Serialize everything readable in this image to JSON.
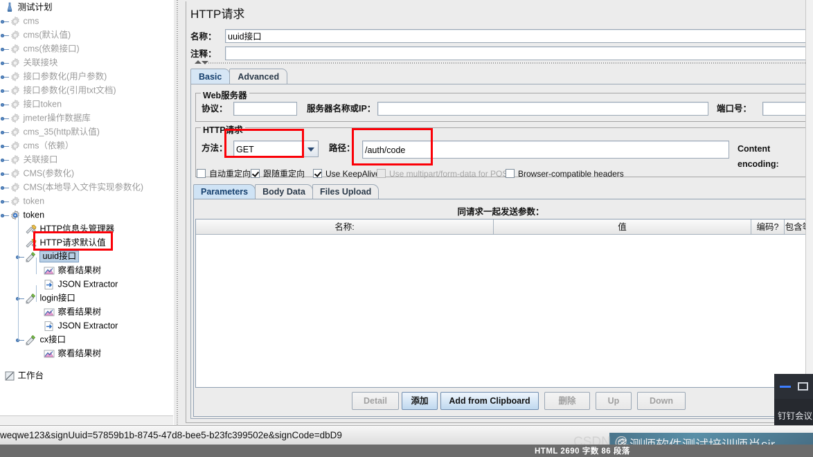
{
  "app": {
    "title": "HTTP请求"
  },
  "tree": {
    "rows": [
      {
        "label": "测试计划",
        "icon": "test-plan-icon",
        "depth": 0,
        "handle": false,
        "dim": false
      },
      {
        "label": "cms",
        "icon": "thread-group-icon",
        "depth": 1,
        "handle": true,
        "dim": true
      },
      {
        "label": "cms(默认值)",
        "icon": "thread-group-icon",
        "depth": 1,
        "handle": true,
        "dim": true
      },
      {
        "label": "cms(依赖接口)",
        "icon": "thread-group-icon",
        "depth": 1,
        "handle": true,
        "dim": true
      },
      {
        "label": "关联接块",
        "icon": "thread-group-icon",
        "depth": 1,
        "handle": true,
        "dim": true
      },
      {
        "label": "接口参数化(用户参数)",
        "icon": "thread-group-icon",
        "depth": 1,
        "handle": true,
        "dim": true
      },
      {
        "label": "接口参数化(引用txt文档)",
        "icon": "thread-group-icon",
        "depth": 1,
        "handle": true,
        "dim": true
      },
      {
        "label": "接口token",
        "icon": "thread-group-icon",
        "depth": 1,
        "handle": true,
        "dim": true
      },
      {
        "label": "jmeter操作数据库",
        "icon": "thread-group-icon",
        "depth": 1,
        "handle": true,
        "dim": true
      },
      {
        "label": "cms_35(http默认值)",
        "icon": "thread-group-icon",
        "depth": 1,
        "handle": true,
        "dim": true
      },
      {
        "label": "cms（依赖）",
        "icon": "thread-group-icon",
        "depth": 1,
        "handle": true,
        "dim": true
      },
      {
        "label": "关联接口",
        "icon": "thread-group-icon",
        "depth": 1,
        "handle": true,
        "dim": true
      },
      {
        "label": "CMS(参数化)",
        "icon": "thread-group-icon",
        "depth": 1,
        "handle": true,
        "dim": true
      },
      {
        "label": "CMS(本地导入文件实现参数化)",
        "icon": "thread-group-icon",
        "depth": 1,
        "handle": true,
        "dim": true
      },
      {
        "label": "token",
        "icon": "thread-group-icon",
        "depth": 1,
        "handle": true,
        "dim": true
      },
      {
        "label": "token",
        "icon": "thread-group-active-icon",
        "depth": 1,
        "handle": true,
        "dim": false
      },
      {
        "label": "HTTP信息头管理器",
        "icon": "config-wrench-icon",
        "depth": 2,
        "handle": false,
        "dim": false
      },
      {
        "label": "HTTP请求默认值",
        "icon": "config-wrench-icon",
        "depth": 2,
        "handle": false,
        "dim": false
      },
      {
        "label": "uuid接口",
        "icon": "http-sampler-icon",
        "depth": 2,
        "handle": true,
        "dim": false,
        "selected": true
      },
      {
        "label": "察看结果树",
        "icon": "view-results-tree-icon",
        "depth": 3,
        "handle": false,
        "dim": false
      },
      {
        "label": "JSON Extractor",
        "icon": "json-extractor-icon",
        "depth": 3,
        "handle": false,
        "dim": false
      },
      {
        "label": "login接口",
        "icon": "http-sampler-icon",
        "depth": 2,
        "handle": true,
        "dim": false
      },
      {
        "label": "察看结果树",
        "icon": "view-results-tree-icon",
        "depth": 3,
        "handle": false,
        "dim": false
      },
      {
        "label": "JSON Extractor",
        "icon": "json-extractor-icon",
        "depth": 3,
        "handle": false,
        "dim": false
      },
      {
        "label": "cx接口",
        "icon": "http-sampler-icon",
        "depth": 2,
        "handle": true,
        "dim": false
      },
      {
        "label": "察看结果树",
        "icon": "view-results-tree-icon",
        "depth": 3,
        "handle": false,
        "dim": false
      },
      {
        "label": "工作台",
        "icon": "workbench-icon",
        "depth": 0,
        "handle": false,
        "dim": false
      }
    ]
  },
  "form": {
    "name_label": "名称：",
    "name_value": "uuid接口",
    "comment_label": "注释：",
    "comment_value": ""
  },
  "top_tabs": [
    {
      "label": "Basic",
      "active": true
    },
    {
      "label": "Advanced",
      "active": false
    }
  ],
  "webserver": {
    "legend": "Web服务器",
    "protocol_label": "协议：",
    "protocol_value": "",
    "server_label": "服务器名称或IP：",
    "server_value": "",
    "port_label": "端口号：",
    "port_value": ""
  },
  "httprequest": {
    "legend": "HTTP请求",
    "method_label": "方法：",
    "method_value": "GET",
    "path_label": "路径：",
    "path_value": "/auth/code",
    "encoding_label": "Content encoding:",
    "encoding_value": ""
  },
  "checkboxes": [
    {
      "label": "自动重定向",
      "checked": false,
      "disabled": false
    },
    {
      "label": "跟随重定向",
      "checked": true,
      "disabled": false
    },
    {
      "label": "Use KeepAlive",
      "checked": true,
      "disabled": false
    },
    {
      "label": "Use multipart/form-data for POST",
      "checked": false,
      "disabled": true
    },
    {
      "label": "Browser-compatible headers",
      "checked": false,
      "disabled": false
    }
  ],
  "param_tabs": [
    {
      "label": "Parameters",
      "active": true
    },
    {
      "label": "Body Data",
      "active": false
    },
    {
      "label": "Files Upload",
      "active": false
    }
  ],
  "params_table": {
    "title": "同请求一起发送参数：",
    "columns": [
      "名称:",
      "值",
      "编码?",
      "包含等"
    ],
    "rows": []
  },
  "buttons": [
    {
      "label": "Detail",
      "state": "disabled"
    },
    {
      "label": "添加",
      "state": "enabled"
    },
    {
      "label": "Add from Clipboard",
      "state": "enabled"
    },
    {
      "label": "删除",
      "state": "disabled"
    },
    {
      "label": "Up",
      "state": "disabled"
    },
    {
      "label": "Down",
      "state": "disabled"
    }
  ],
  "statusbar": {
    "url_text": "weqwe123&signUuid=57859b1b-8745-47d8-bee5-b23fc399502e&signCode=dbD9"
  },
  "footer": {
    "word_count": "HTML  2690 字数  86 段落",
    "watermark_prefix": "CSDN @",
    "watermark_text": "多测师软件测试培训师肖sir"
  },
  "dingtalk": {
    "label": "钉钉会议",
    "minimize_icon": "minimize-icon",
    "maximize_icon": "maximize-icon"
  },
  "colors": {
    "panel_bg": "#ececec",
    "tab_active": "#d6e6f5",
    "annotation_red": "#fb0007",
    "selection_blue": "#b8cfe5"
  }
}
